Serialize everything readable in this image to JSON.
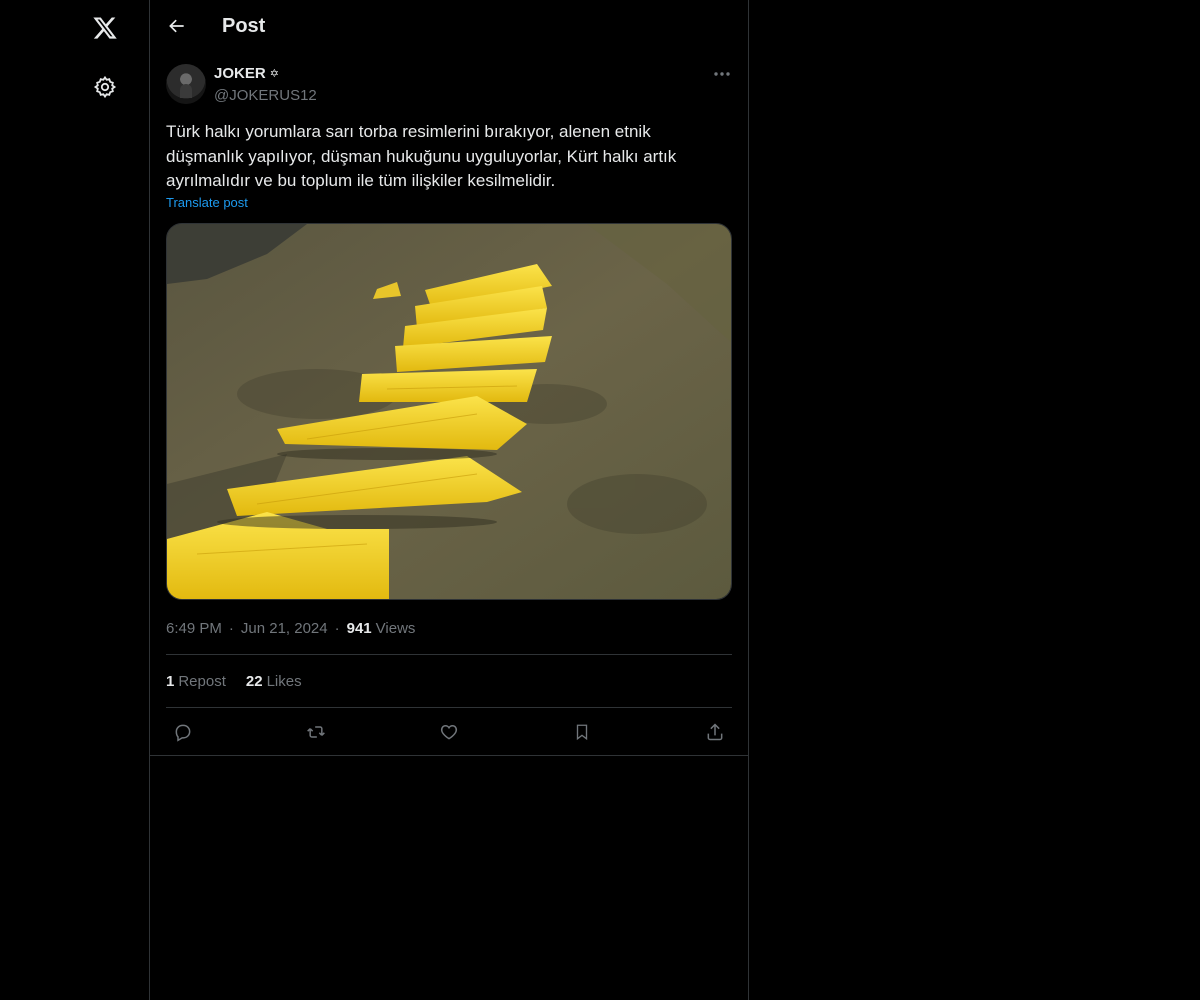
{
  "header": {
    "title": "Post"
  },
  "nav": {
    "logo_icon": "x-logo-icon",
    "settings_icon": "gear-icon"
  },
  "post": {
    "display_name": "JOKER",
    "name_badge": "✡",
    "handle": "@JOKERUS12",
    "text": "Türk halkı yorumlara sarı torba resimlerini bırakıyor, alenen etnik düşmanlık yapılıyor, düşman hukuğunu uyguluyorlar, Kürt halkı artık ayrılmalıdır ve bu toplum ile tüm ilişkiler kesilmelidir.",
    "translate_label": "Translate post",
    "time": "6:49 PM",
    "date": "Jun 21, 2024",
    "views_count": "941",
    "views_label": "Views",
    "reposts_count": "1",
    "reposts_label": "Repost",
    "likes_count": "22",
    "likes_label": "Likes",
    "separator": "·"
  },
  "actions": [
    "reply-icon",
    "repost-icon",
    "like-icon",
    "bookmark-icon",
    "share-icon"
  ],
  "colors": {
    "background": "#000000",
    "text": "#e7e9ea",
    "muted": "#71767b",
    "link": "#1d9bf0",
    "border": "#2f3336",
    "bag_yellow": "#f3d21a"
  }
}
